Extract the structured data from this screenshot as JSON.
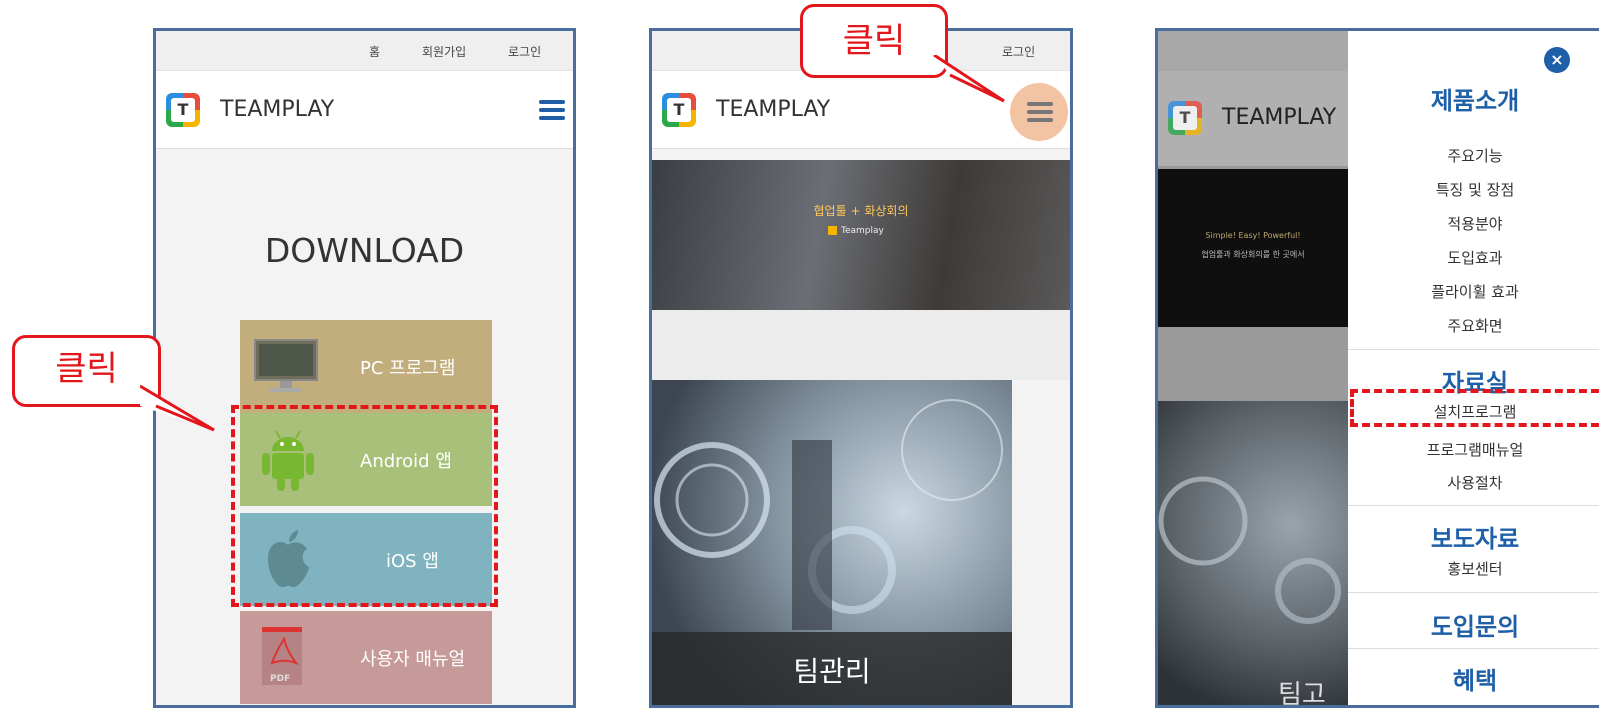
{
  "callout": {
    "click_label": "클릭"
  },
  "panel1": {
    "topbar": {
      "home": "홈",
      "signup": "회원가입",
      "login": "로그인"
    },
    "brand": "TEAMPLAY",
    "title": "DOWNLOAD",
    "buttons": [
      {
        "label": "PC 프로그램",
        "color": "#c2ae7c"
      },
      {
        "label": "Android 앱",
        "color": "#a9c07a"
      },
      {
        "label": "iOS 앱",
        "color": "#7fb3c0"
      },
      {
        "label": "사용자 매뉴얼",
        "color": "#c79a9a"
      }
    ]
  },
  "panel2": {
    "topbar": {
      "login": "로그인"
    },
    "brand": "TEAMPLAY",
    "banner_title": "협업툴 + 화상회의",
    "banner_brand": "Teamplay",
    "card_label": "팀관리"
  },
  "panel3": {
    "brand": "TEAMPLAY",
    "banner_line1": "Simple! Easy! Powerful!",
    "banner_line2": "협업툴과 화상회의를 한 곳에서",
    "bottom_text": "팀고",
    "menu": {
      "section1": {
        "title": "제품소개",
        "items": [
          "주요기능",
          "특징 및 장점",
          "적용분야",
          "도입효과",
          "플라이휠 효과",
          "주요화면"
        ]
      },
      "section2": {
        "title": "자료실",
        "items": [
          "설치프로그램",
          "프로그램매뉴얼",
          "사용절차"
        ]
      },
      "section3": {
        "title": "보도자료",
        "items": [
          "홍보센터"
        ]
      },
      "section4": {
        "title": "도입문의"
      },
      "section5": {
        "title": "혜택"
      }
    }
  },
  "colors": {
    "accent_red": "#e3161b",
    "menu_blue": "#1f5fa8",
    "frame_blue": "#4a6e9c"
  }
}
